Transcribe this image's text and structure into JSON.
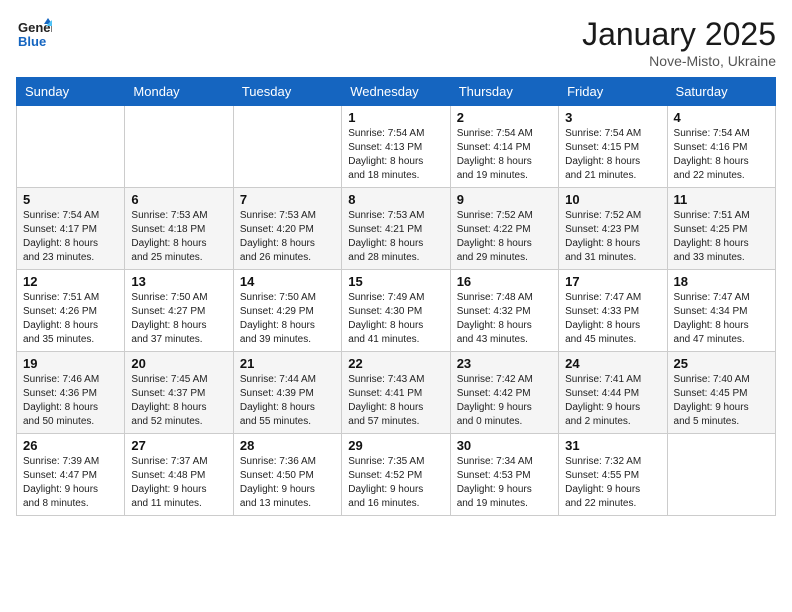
{
  "header": {
    "logo_line1": "General",
    "logo_line2": "Blue",
    "month": "January 2025",
    "location": "Nove-Misto, Ukraine"
  },
  "weekdays": [
    "Sunday",
    "Monday",
    "Tuesday",
    "Wednesday",
    "Thursday",
    "Friday",
    "Saturday"
  ],
  "weeks": [
    [
      {
        "day": "",
        "info": ""
      },
      {
        "day": "",
        "info": ""
      },
      {
        "day": "",
        "info": ""
      },
      {
        "day": "1",
        "info": "Sunrise: 7:54 AM\nSunset: 4:13 PM\nDaylight: 8 hours\nand 18 minutes."
      },
      {
        "day": "2",
        "info": "Sunrise: 7:54 AM\nSunset: 4:14 PM\nDaylight: 8 hours\nand 19 minutes."
      },
      {
        "day": "3",
        "info": "Sunrise: 7:54 AM\nSunset: 4:15 PM\nDaylight: 8 hours\nand 21 minutes."
      },
      {
        "day": "4",
        "info": "Sunrise: 7:54 AM\nSunset: 4:16 PM\nDaylight: 8 hours\nand 22 minutes."
      }
    ],
    [
      {
        "day": "5",
        "info": "Sunrise: 7:54 AM\nSunset: 4:17 PM\nDaylight: 8 hours\nand 23 minutes."
      },
      {
        "day": "6",
        "info": "Sunrise: 7:53 AM\nSunset: 4:18 PM\nDaylight: 8 hours\nand 25 minutes."
      },
      {
        "day": "7",
        "info": "Sunrise: 7:53 AM\nSunset: 4:20 PM\nDaylight: 8 hours\nand 26 minutes."
      },
      {
        "day": "8",
        "info": "Sunrise: 7:53 AM\nSunset: 4:21 PM\nDaylight: 8 hours\nand 28 minutes."
      },
      {
        "day": "9",
        "info": "Sunrise: 7:52 AM\nSunset: 4:22 PM\nDaylight: 8 hours\nand 29 minutes."
      },
      {
        "day": "10",
        "info": "Sunrise: 7:52 AM\nSunset: 4:23 PM\nDaylight: 8 hours\nand 31 minutes."
      },
      {
        "day": "11",
        "info": "Sunrise: 7:51 AM\nSunset: 4:25 PM\nDaylight: 8 hours\nand 33 minutes."
      }
    ],
    [
      {
        "day": "12",
        "info": "Sunrise: 7:51 AM\nSunset: 4:26 PM\nDaylight: 8 hours\nand 35 minutes."
      },
      {
        "day": "13",
        "info": "Sunrise: 7:50 AM\nSunset: 4:27 PM\nDaylight: 8 hours\nand 37 minutes."
      },
      {
        "day": "14",
        "info": "Sunrise: 7:50 AM\nSunset: 4:29 PM\nDaylight: 8 hours\nand 39 minutes."
      },
      {
        "day": "15",
        "info": "Sunrise: 7:49 AM\nSunset: 4:30 PM\nDaylight: 8 hours\nand 41 minutes."
      },
      {
        "day": "16",
        "info": "Sunrise: 7:48 AM\nSunset: 4:32 PM\nDaylight: 8 hours\nand 43 minutes."
      },
      {
        "day": "17",
        "info": "Sunrise: 7:47 AM\nSunset: 4:33 PM\nDaylight: 8 hours\nand 45 minutes."
      },
      {
        "day": "18",
        "info": "Sunrise: 7:47 AM\nSunset: 4:34 PM\nDaylight: 8 hours\nand 47 minutes."
      }
    ],
    [
      {
        "day": "19",
        "info": "Sunrise: 7:46 AM\nSunset: 4:36 PM\nDaylight: 8 hours\nand 50 minutes."
      },
      {
        "day": "20",
        "info": "Sunrise: 7:45 AM\nSunset: 4:37 PM\nDaylight: 8 hours\nand 52 minutes."
      },
      {
        "day": "21",
        "info": "Sunrise: 7:44 AM\nSunset: 4:39 PM\nDaylight: 8 hours\nand 55 minutes."
      },
      {
        "day": "22",
        "info": "Sunrise: 7:43 AM\nSunset: 4:41 PM\nDaylight: 8 hours\nand 57 minutes."
      },
      {
        "day": "23",
        "info": "Sunrise: 7:42 AM\nSunset: 4:42 PM\nDaylight: 9 hours\nand 0 minutes."
      },
      {
        "day": "24",
        "info": "Sunrise: 7:41 AM\nSunset: 4:44 PM\nDaylight: 9 hours\nand 2 minutes."
      },
      {
        "day": "25",
        "info": "Sunrise: 7:40 AM\nSunset: 4:45 PM\nDaylight: 9 hours\nand 5 minutes."
      }
    ],
    [
      {
        "day": "26",
        "info": "Sunrise: 7:39 AM\nSunset: 4:47 PM\nDaylight: 9 hours\nand 8 minutes."
      },
      {
        "day": "27",
        "info": "Sunrise: 7:37 AM\nSunset: 4:48 PM\nDaylight: 9 hours\nand 11 minutes."
      },
      {
        "day": "28",
        "info": "Sunrise: 7:36 AM\nSunset: 4:50 PM\nDaylight: 9 hours\nand 13 minutes."
      },
      {
        "day": "29",
        "info": "Sunrise: 7:35 AM\nSunset: 4:52 PM\nDaylight: 9 hours\nand 16 minutes."
      },
      {
        "day": "30",
        "info": "Sunrise: 7:34 AM\nSunset: 4:53 PM\nDaylight: 9 hours\nand 19 minutes."
      },
      {
        "day": "31",
        "info": "Sunrise: 7:32 AM\nSunset: 4:55 PM\nDaylight: 9 hours\nand 22 minutes."
      },
      {
        "day": "",
        "info": ""
      }
    ]
  ]
}
